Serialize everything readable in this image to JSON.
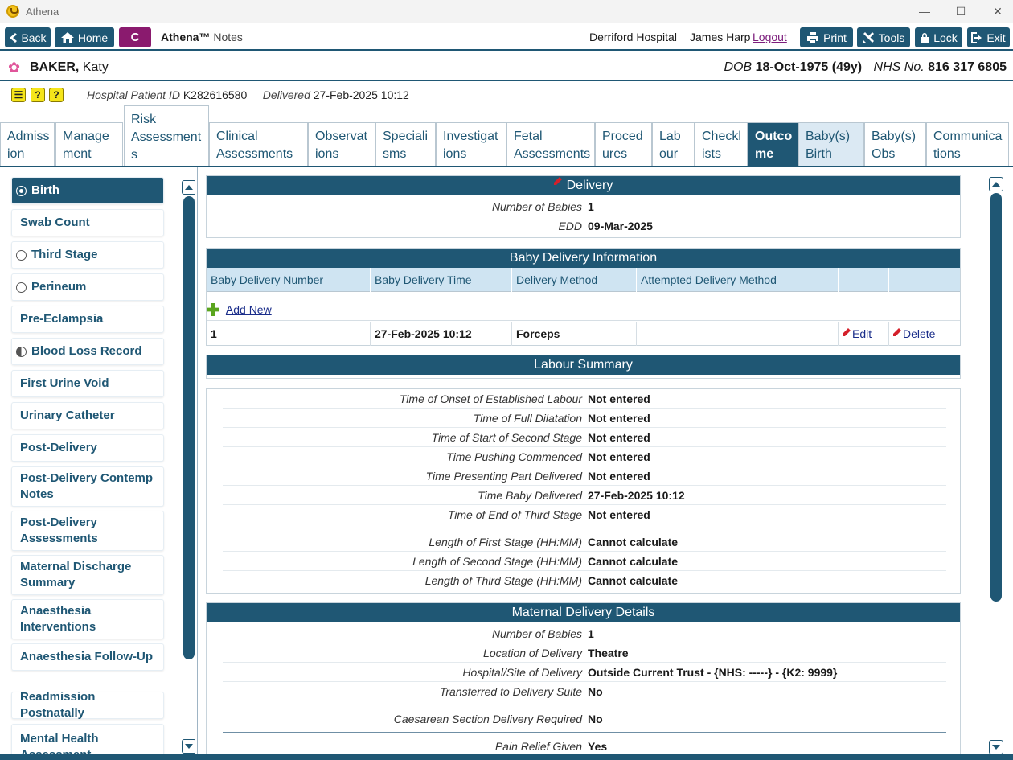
{
  "window": {
    "title": "Athena",
    "min_glyph": "—",
    "max_glyph": "☐",
    "close_glyph": "✕"
  },
  "toolbar": {
    "back": "Back",
    "home": "Home",
    "c_label": "C",
    "brand": "Athena™",
    "brand_suffix": "Notes",
    "hospital": "Derriford Hospital",
    "user": "James Harp",
    "logout": "Logout",
    "print": "Print",
    "tools": "Tools",
    "lock": "Lock",
    "exit": "Exit"
  },
  "patient": {
    "surname": "BAKER,",
    "forename": "Katy",
    "dob_label": "DOB",
    "dob": "18-Oct-1975 (49y)",
    "nhs_label": "NHS No.",
    "nhs": "816 317 6805",
    "hosp_id_label": "Hospital Patient ID",
    "hosp_id": "K282616580",
    "delivered_label": "Delivered",
    "delivered": "27-Feb-2025 10:12"
  },
  "tabs": [
    {
      "l1": "Admiss",
      "l2": "ion"
    },
    {
      "l1": "Manage",
      "l2": "ment"
    },
    {
      "l1": "Risk",
      "l2": "Assessment",
      "l3": "s"
    },
    {
      "l1": "Clinical",
      "l2": "Assessments"
    },
    {
      "l1": "Observat",
      "l2": "ions"
    },
    {
      "l1": "Speciali",
      "l2": "sms"
    },
    {
      "l1": "Investigat",
      "l2": "ions"
    },
    {
      "l1": "Fetal",
      "l2": "Assessments"
    },
    {
      "l1": "Proced",
      "l2": "ures"
    },
    {
      "l1": "Lab",
      "l2": "our"
    },
    {
      "l1": "Checkl",
      "l2": "ists"
    },
    {
      "l1": "Outco",
      "l2": "me"
    },
    {
      "l1": "Baby(s)",
      "l2": "Birth"
    },
    {
      "l1": "Baby(s)",
      "l2": "Obs"
    },
    {
      "l1": "Communica",
      "l2": "tions"
    }
  ],
  "nav": [
    {
      "label": "Birth"
    },
    {
      "label": "Swab Count"
    },
    {
      "label": "Third Stage"
    },
    {
      "label": "Perineum"
    },
    {
      "label": "Pre-Eclampsia"
    },
    {
      "label": "Blood Loss Record"
    },
    {
      "label": "First Urine Void"
    },
    {
      "label": "Urinary Catheter"
    },
    {
      "label": "Post-Delivery"
    },
    {
      "label": "Post-Delivery Contemp Notes"
    },
    {
      "label": "Post-Delivery Assessments"
    },
    {
      "label": "Maternal Discharge Summary"
    },
    {
      "label": "Anaesthesia Interventions"
    },
    {
      "label": "Anaesthesia Follow-Up"
    },
    {
      "label": "Readmission Postnatally"
    },
    {
      "label": "Mental Health Assessment"
    }
  ],
  "delivery": {
    "title": "Delivery",
    "rows": [
      {
        "label": "Number of Babies",
        "value": "1"
      },
      {
        "label": "EDD",
        "value": "09-Mar-2025"
      }
    ]
  },
  "baby_info": {
    "title": "Baby Delivery Information",
    "columns": [
      "Baby Delivery Number",
      "Baby Delivery Time",
      "Delivery Method",
      "Attempted Delivery Method"
    ],
    "add_new": "Add New",
    "rows": [
      {
        "number": "1",
        "time": "27-Feb-2025 10:12",
        "method": "Forceps",
        "attempted": "",
        "edit": "Edit",
        "delete": "Delete"
      }
    ]
  },
  "labour": {
    "title": "Labour Summary",
    "rows": [
      {
        "label": "Time of Onset of Established Labour",
        "value": "Not entered"
      },
      {
        "label": "Time of Full Dilatation",
        "value": "Not entered"
      },
      {
        "label": "Time of Start of Second Stage",
        "value": "Not entered"
      },
      {
        "label": "Time Pushing Commenced",
        "value": "Not entered"
      },
      {
        "label": "Time Presenting Part Delivered",
        "value": "Not entered"
      },
      {
        "label": "Time Baby Delivered",
        "value": "27-Feb-2025 10:12"
      },
      {
        "label": "Time of End of Third Stage",
        "value": "Not entered"
      },
      {
        "label": "Length of First Stage (HH:MM)",
        "value": "Cannot calculate"
      },
      {
        "label": "Length of Second Stage (HH:MM)",
        "value": "Cannot calculate"
      },
      {
        "label": "Length of Third Stage (HH:MM)",
        "value": "Cannot calculate"
      }
    ]
  },
  "maternal": {
    "title": "Maternal Delivery Details",
    "rows": [
      {
        "label": "Number of Babies",
        "value": "1"
      },
      {
        "label": "Location of Delivery",
        "value": "Theatre"
      },
      {
        "label": "Hospital/Site of Delivery",
        "value": "Outside Current Trust - {NHS: -----} - {K2: 9999}"
      },
      {
        "label": "Transferred to Delivery Suite",
        "value": "No"
      },
      {
        "label": "Caesarean Section Delivery Required",
        "value": "No"
      },
      {
        "label": "Pain Relief Given",
        "value": "Yes"
      }
    ]
  },
  "colors": {
    "primary": "#1f5774",
    "accent_c": "#8a1a6e",
    "header_light": "#cfe4f2"
  }
}
